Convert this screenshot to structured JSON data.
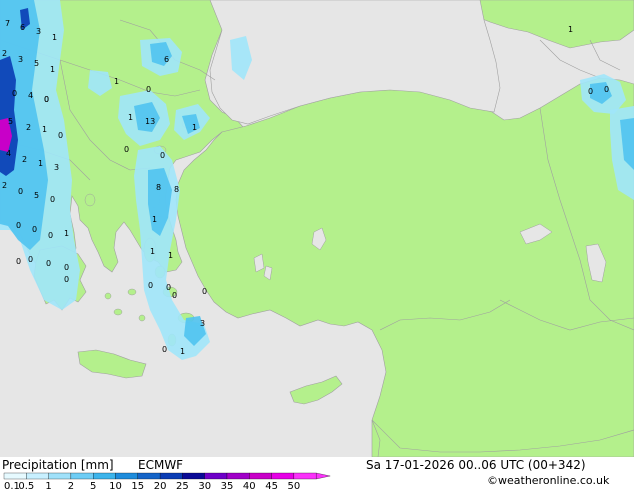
{
  "footer": {
    "title": "Precipitation [mm]",
    "model": "ECMWF",
    "datetime": "Sa 17-01-2026 00..06 UTC (00+342)",
    "credit": "©weatheronline.co.uk"
  },
  "legend": {
    "values": [
      "0.1",
      "0.5",
      "1",
      "2",
      "5",
      "10",
      "15",
      "20",
      "25",
      "30",
      "35",
      "40",
      "45",
      "50"
    ],
    "colors": [
      "#e6faff",
      "#c8f0ff",
      "#a0e1fa",
      "#6ecdf5",
      "#3cb4eb",
      "#1e8cdc",
      "#1464c8",
      "#0a3cb4",
      "#0a0a96",
      "#6e00c8",
      "#a000c8",
      "#c800c8",
      "#e600e6",
      "#fa32fa"
    ]
  },
  "colors": {
    "sea": "#e6e6e6",
    "land": "#b4f08c",
    "border": "#a0a0a0",
    "precip_light": "#a0e6fa",
    "precip_medium": "#50c3f0",
    "precip_heavy": "#0a3cb4",
    "precip_extreme": "#c800c8"
  },
  "map_labels": {
    "rain_values": [
      "7",
      "6",
      "3",
      "1",
      "2",
      "3",
      "5",
      "1",
      "0",
      "4",
      "0",
      "5",
      "2",
      "1",
      "0",
      "4",
      "2",
      "1",
      "3",
      "2",
      "0",
      "5",
      "0",
      "0",
      "0",
      "0",
      "1",
      "0",
      "0",
      "0",
      "6",
      "1",
      "0",
      "0",
      "1",
      "0",
      "13",
      "1",
      "0",
      "8",
      "8",
      "1",
      "1",
      "1",
      "0",
      "0",
      "3",
      "0",
      "0",
      "0",
      "1",
      "0",
      "0",
      "1",
      "0",
      "0"
    ]
  }
}
